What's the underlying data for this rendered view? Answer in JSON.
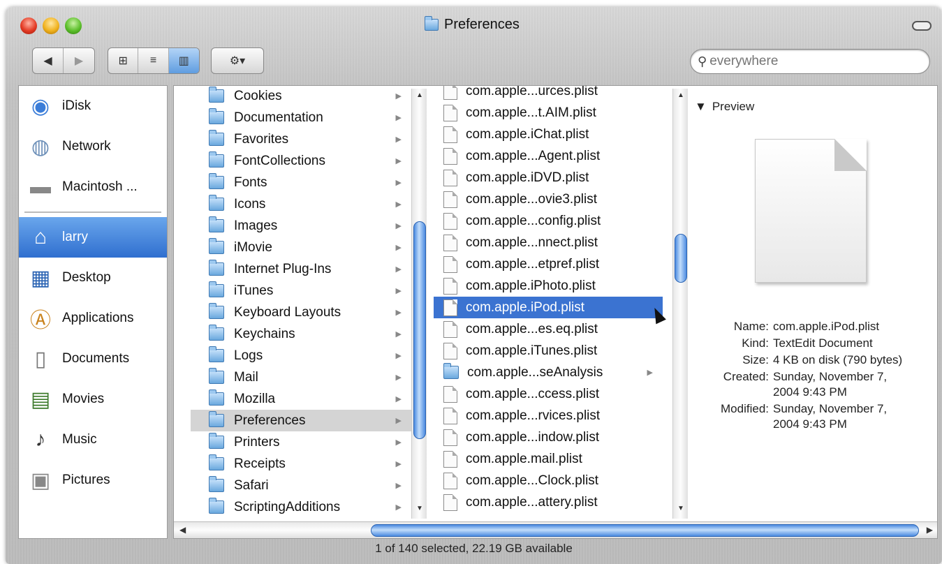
{
  "window": {
    "title": "Preferences"
  },
  "toolbar": {
    "back_label": "◀",
    "forward_label": "▶",
    "view_icon_label": "⊞",
    "view_list_label": "≡",
    "view_column_label": "▥",
    "action_label": "⚙▾",
    "search_placeholder": "everywhere"
  },
  "sidebar": {
    "items": [
      {
        "label": "iDisk",
        "icon": "idisk-icon"
      },
      {
        "label": "Network",
        "icon": "network-icon"
      },
      {
        "label": "Macintosh ...",
        "icon": "harddisk-icon"
      },
      {
        "label": "larry",
        "icon": "home-icon",
        "selected": true
      },
      {
        "label": "Desktop",
        "icon": "desktop-icon"
      },
      {
        "label": "Applications",
        "icon": "applications-icon"
      },
      {
        "label": "Documents",
        "icon": "documents-icon"
      },
      {
        "label": "Movies",
        "icon": "movies-icon"
      },
      {
        "label": "Music",
        "icon": "music-icon"
      },
      {
        "label": "Pictures",
        "icon": "pictures-icon"
      }
    ]
  },
  "column1": {
    "items": [
      "Cookies",
      "Documentation",
      "Favorites",
      "FontCollections",
      "Fonts",
      "Icons",
      "Images",
      "iMovie",
      "Internet Plug-Ins",
      "iTunes",
      "Keyboard Layouts",
      "Keychains",
      "Logs",
      "Mail",
      "Mozilla",
      "Preferences",
      "Printers",
      "Receipts",
      "Safari",
      "ScriptingAdditions"
    ],
    "selected": "Preferences"
  },
  "column2": {
    "items": [
      {
        "label": "com.apple...urces.plist",
        "type": "file"
      },
      {
        "label": "com.apple...t.AIM.plist",
        "type": "file"
      },
      {
        "label": "com.apple.iChat.plist",
        "type": "file"
      },
      {
        "label": "com.apple...Agent.plist",
        "type": "file"
      },
      {
        "label": "com.apple.iDVD.plist",
        "type": "file"
      },
      {
        "label": "com.apple...ovie3.plist",
        "type": "file"
      },
      {
        "label": "com.apple...config.plist",
        "type": "file"
      },
      {
        "label": "com.apple...nnect.plist",
        "type": "file"
      },
      {
        "label": "com.apple...etpref.plist",
        "type": "file"
      },
      {
        "label": "com.apple.iPhoto.plist",
        "type": "file"
      },
      {
        "label": "com.apple.iPod.plist",
        "type": "file",
        "selected": true
      },
      {
        "label": "com.apple...es.eq.plist",
        "type": "file"
      },
      {
        "label": "com.apple.iTunes.plist",
        "type": "file"
      },
      {
        "label": "com.apple...seAnalysis",
        "type": "folder"
      },
      {
        "label": "com.apple...ccess.plist",
        "type": "file"
      },
      {
        "label": "com.apple...rvices.plist",
        "type": "file"
      },
      {
        "label": "com.apple...indow.plist",
        "type": "file"
      },
      {
        "label": "com.apple.mail.plist",
        "type": "file"
      },
      {
        "label": "com.apple...Clock.plist",
        "type": "file"
      },
      {
        "label": "com.apple...attery.plist",
        "type": "file"
      }
    ]
  },
  "preview": {
    "header": "Preview",
    "name_key": "Name:",
    "name": "com.apple.iPod.plist",
    "kind_key": "Kind:",
    "kind": "TextEdit Document",
    "size_key": "Size:",
    "size": "4 KB on disk (790 bytes)",
    "created_key": "Created:",
    "created": "Sunday, November 7, 2004 9:43 PM",
    "modified_key": "Modified:",
    "modified": "Sunday, November 7, 2004 9:43 PM"
  },
  "status": {
    "text": "1 of 140 selected, 22.19 GB available"
  },
  "colors": {
    "selection_blue": "#3b73d1",
    "sidebar_selected": "#2f6fcf",
    "folder_blue": "#6aa8de"
  }
}
